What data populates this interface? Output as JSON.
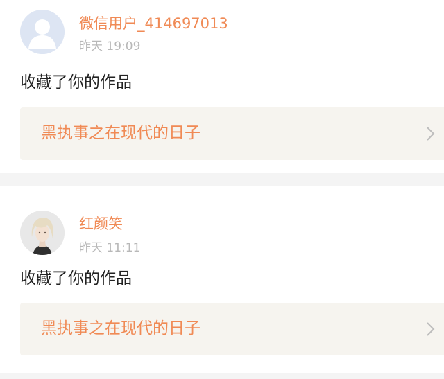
{
  "notifications": [
    {
      "avatar_icon": "default-user-avatar-icon",
      "username": "微信用户_414697013",
      "timestamp": "昨天 19:09",
      "action_text": "收藏了你的作品",
      "work_title": "黑执事之在现代的日子",
      "chevron_icon": "chevron-right-icon"
    },
    {
      "avatar_icon": "profile-photo-avatar-icon",
      "username": "红颜笑",
      "timestamp": "昨天 11:11",
      "action_text": "收藏了你的作品",
      "work_title": "黑执事之在现代的日子",
      "chevron_icon": "chevron-right-icon"
    }
  ],
  "colors": {
    "accent": "#f08a55",
    "timestamp": "#b8b8b8",
    "body_text": "#222222",
    "link_background": "#f6f4ef",
    "page_background": "#f4f4f4"
  }
}
